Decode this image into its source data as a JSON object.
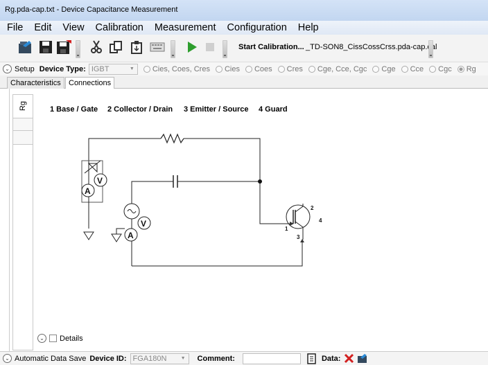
{
  "window": {
    "title": "Rg.pda-cap.txt - Device Capacitance Measurement"
  },
  "menu": [
    "File",
    "Edit",
    "View",
    "Calibration",
    "Measurement",
    "Configuration",
    "Help"
  ],
  "toolbar": {
    "start_calibration_label": "Start Calibration...",
    "cal_file": "_TD-SON8_CissCossCrss.pda-cap.cal",
    "icons": [
      "open-folder-icon",
      "save-icon",
      "save-as-icon",
      "cut-icon",
      "copy-icon",
      "paste-icon",
      "keyboard-icon",
      "play-icon",
      "stop-icon"
    ]
  },
  "setup": {
    "label": "Setup",
    "device_type_label": "Device Type:",
    "device_type_value": "IGBT",
    "options": [
      "Cies, Coes, Cres",
      "Cies",
      "Coes",
      "Cres",
      "Cge, Cce, Cgc",
      "Cge",
      "Cce",
      "Cgc",
      "Rg"
    ],
    "selected_option": "Rg"
  },
  "tabs": [
    "Characteristics",
    "Connections"
  ],
  "active_tab": "Connections",
  "side_tab": "Rg",
  "connections": {
    "labels": [
      "1 Base / Gate",
      "2 Collector / Drain",
      "3 Emitter / Source",
      "4 Guard"
    ]
  },
  "schematic": {
    "meter_labels": [
      "A",
      "V"
    ],
    "pin_labels": [
      "1",
      "2",
      "3",
      "4"
    ]
  },
  "details_label": "Details",
  "bottom": {
    "auto_save_label": "Automatic Data Save",
    "device_id_label": "Device ID:",
    "device_id_value": "FGA180N",
    "comment_label": "Comment:",
    "comment_value": "",
    "data_label": "Data:"
  },
  "colors": {
    "title_bg": "#c9dbf2",
    "play_green": "#2e9e2e",
    "delete_red": "#d22020"
  }
}
